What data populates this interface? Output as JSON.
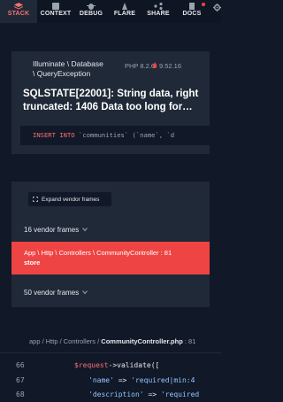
{
  "nav": {
    "items": [
      {
        "label": "STACK",
        "icon": "stack-icon",
        "active": true
      },
      {
        "label": "CONTEXT",
        "icon": "context-icon",
        "active": false
      },
      {
        "label": "DEBUG",
        "icon": "debug-icon",
        "active": false
      },
      {
        "label": "FLARE",
        "icon": "flare-icon",
        "active": false
      },
      {
        "label": "SHARE",
        "icon": "share-icon",
        "active": false
      },
      {
        "label": "DOCS",
        "icon": "docs-icon",
        "active": false
      }
    ],
    "settings_icon": "gear-icon"
  },
  "exception": {
    "class_line1": "Illuminate \\ Database",
    "class_line2": "\\ QueryException",
    "php_version": "PHP 8.2.6",
    "laravel_version": "9.52.16",
    "message": "SQLSTATE[22001]: String data, right truncated: 1406 Data too long for…",
    "sql_keyword": "INSERT INTO",
    "sql_rest": " `communities` (`name`, `d"
  },
  "frames": {
    "expand_label": "Expand vendor frames",
    "vendor_group_1": "16 vendor frames",
    "app_frame_path": "App \\ Http \\ Controllers \\ CommunityController : 81",
    "app_frame_function": "store",
    "vendor_group_2": "50 vendor frames"
  },
  "code": {
    "path_prefix": "app / Http / Controllers / ",
    "path_file": "CommunityController.php",
    "path_suffix": " : 81",
    "lines": [
      {
        "number": "66",
        "var": "$request",
        "rest": "->validate(["
      },
      {
        "number": "67",
        "key": "'name'",
        "arrow": " => ",
        "value": "'required|min:4"
      },
      {
        "number": "68",
        "key": "'description'",
        "arrow": " => ",
        "value": "'required"
      }
    ]
  },
  "colors": {
    "background": "#111827",
    "panel": "#1f2937",
    "accent_red": "#ef4444",
    "string_blue": "#93c5fd"
  }
}
